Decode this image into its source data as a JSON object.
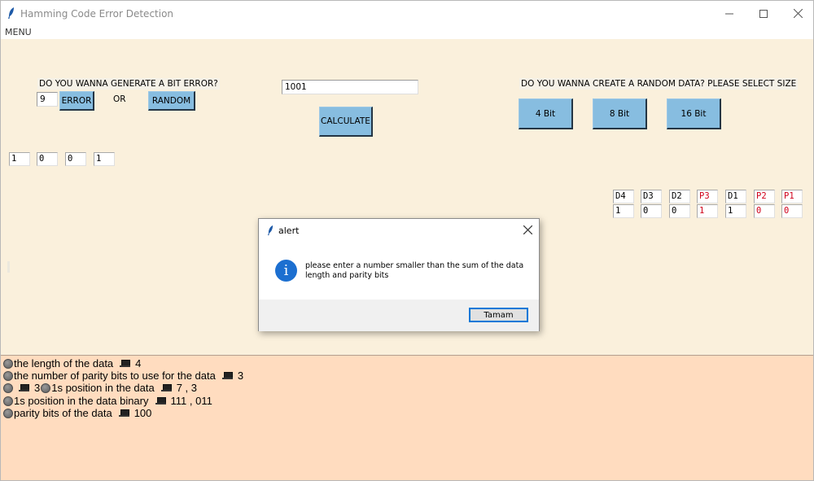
{
  "window": {
    "title": "Hamming Code Error Detection"
  },
  "menu": {
    "label": "MENU"
  },
  "error_section": {
    "prompt": "DO YOU WANNA GENERATE A BIT ERROR?",
    "position_value": "9",
    "error_button": "ERROR",
    "or_text": "OR",
    "random_button": "RANDOM"
  },
  "data_input": {
    "value": "1001",
    "calculate_button": "CALCULATE"
  },
  "random_section": {
    "prompt": "DO YOU WANNA CREATE A RANDOM DATA? PLEASE SELECT SIZE",
    "buttons": [
      "4 Bit",
      "8 Bit",
      "16 Bit"
    ]
  },
  "input_bits": [
    "1",
    "0",
    "0",
    "1"
  ],
  "encoded_table": {
    "headers": [
      "D4",
      "D3",
      "D2",
      "P3",
      "D1",
      "P2",
      "P1"
    ],
    "values": [
      "1",
      "0",
      "0",
      "1",
      "1",
      "0",
      "0"
    ],
    "parity_color": "#d0021b"
  },
  "results": [
    {
      "text": "the length of the data",
      "value": "4"
    },
    {
      "text": "the number of parity bits to use for the data",
      "value": "3"
    },
    {
      "prefix_value": "3",
      "text": "1s position in the data",
      "value": "7 , 3"
    },
    {
      "text": "1s position in the data binary",
      "value": "111 , 011"
    },
    {
      "text": "parity bits of the data",
      "value": "100"
    }
  ],
  "dialog": {
    "title": "alert",
    "message": "please enter a number smaller than the sum of the data length and parity bits",
    "ok_button": "Tamam"
  },
  "colors": {
    "main_bg": "#faf0dc",
    "results_bg": "#ffdcbf",
    "button_bg": "#87bde0",
    "info_icon": "#1c6fd0"
  }
}
